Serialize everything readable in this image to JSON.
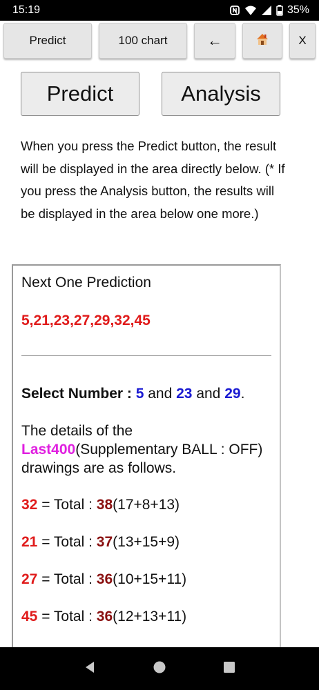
{
  "status": {
    "time": "15:19",
    "battery": "35%"
  },
  "toolbar": {
    "predict": "Predict",
    "chart": "100 chart",
    "back": "←",
    "home": "🏠",
    "close": "X"
  },
  "main": {
    "predict_btn": "Predict",
    "analysis_btn": "Analysis",
    "description": "When you press the Predict button, the result will be displayed in the area directly below. (* If you press the Analysis button, the results will be displayed in the area below one more.)"
  },
  "panel": {
    "title": "Next One Prediction",
    "numbers": "5,21,23,27,29,32,45",
    "select_label": "Select Number : ",
    "select_n1": "5",
    "and1": " and ",
    "select_n2": "23",
    "and2": " and ",
    "select_n3": "29",
    "period": ".",
    "details_pre": "The details of the ",
    "details_hl": "Last400",
    "details_post": "(Supplementary BALL : OFF) drawings are as follows.",
    "rows": [
      {
        "num": "32",
        "eq": " = Total : ",
        "total": "38",
        "breakdown": "(17+8+13)"
      },
      {
        "num": "21",
        "eq": " = Total : ",
        "total": "37",
        "breakdown": "(13+15+9)"
      },
      {
        "num": "27",
        "eq": " = Total : ",
        "total": "36",
        "breakdown": "(10+15+11)"
      },
      {
        "num": "45",
        "eq": " = Total : ",
        "total": "36",
        "breakdown": "(12+13+11)"
      }
    ]
  },
  "colors": {
    "red": "#e01b1b",
    "dark_red": "#8a1010",
    "blue": "#1a1ad2",
    "magenta": "#e020e0"
  },
  "icons": [
    "nfc-icon",
    "wifi-icon",
    "signal-icon",
    "battery-icon",
    "back-triangle-icon",
    "home-circle-icon",
    "recents-square-icon",
    "house-icon"
  ]
}
